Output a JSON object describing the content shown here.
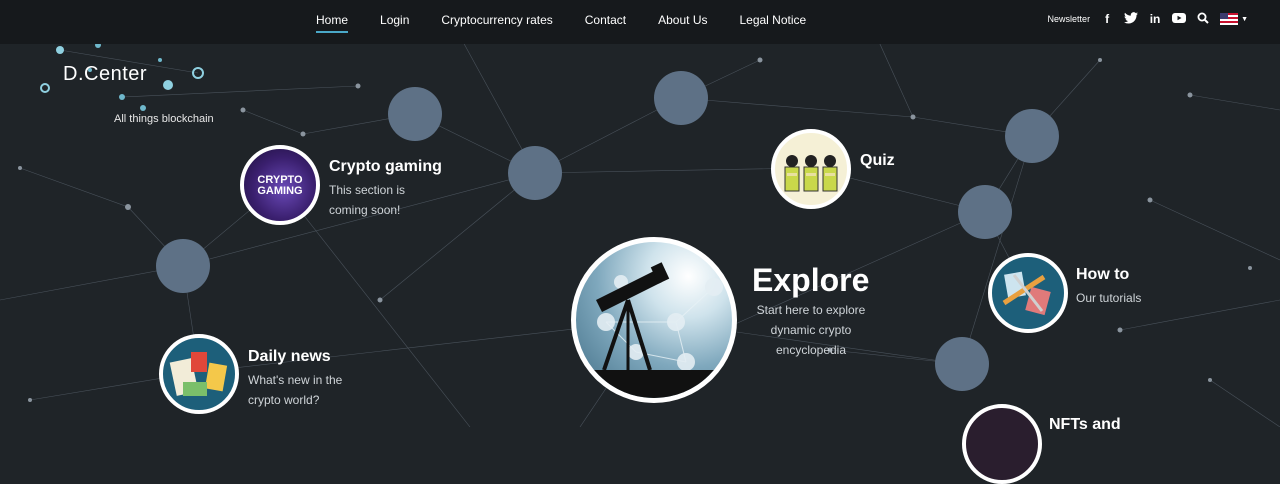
{
  "nav": {
    "items": [
      {
        "label": "Home",
        "active": true
      },
      {
        "label": "Login"
      },
      {
        "label": "Cryptocurrency rates"
      },
      {
        "label": "Contact"
      },
      {
        "label": "About Us"
      },
      {
        "label": "Legal Notice"
      }
    ],
    "newsletter": "Newsletter",
    "social_icons": [
      "facebook-icon",
      "twitter-icon",
      "linkedin-icon",
      "youtube-icon"
    ],
    "language": "en-us-flag"
  },
  "brand": {
    "name": "D.Center",
    "tagline": "All things blockchain"
  },
  "sections": {
    "crypto_gaming": {
      "title": "Crypto gaming",
      "line1": "This section is",
      "line2": "coming soon!",
      "badge_line1": "CRYPTO",
      "badge_line2": "GAMING"
    },
    "quiz": {
      "title": "Quiz"
    },
    "explore": {
      "title": "Explore",
      "line1": "Start here to explore",
      "line2": "dynamic crypto",
      "line3": "encyclopedia"
    },
    "how_to": {
      "title": "How to",
      "line1": "Our tutorials"
    },
    "daily_news": {
      "title": "Daily news",
      "line1": "What's new in the",
      "line2": "crypto world?"
    },
    "nfts": {
      "title": "NFTs and"
    }
  },
  "colors": {
    "background": "#1f2428",
    "bubble": "#5e7186",
    "accent": "#4aa8c8"
  }
}
